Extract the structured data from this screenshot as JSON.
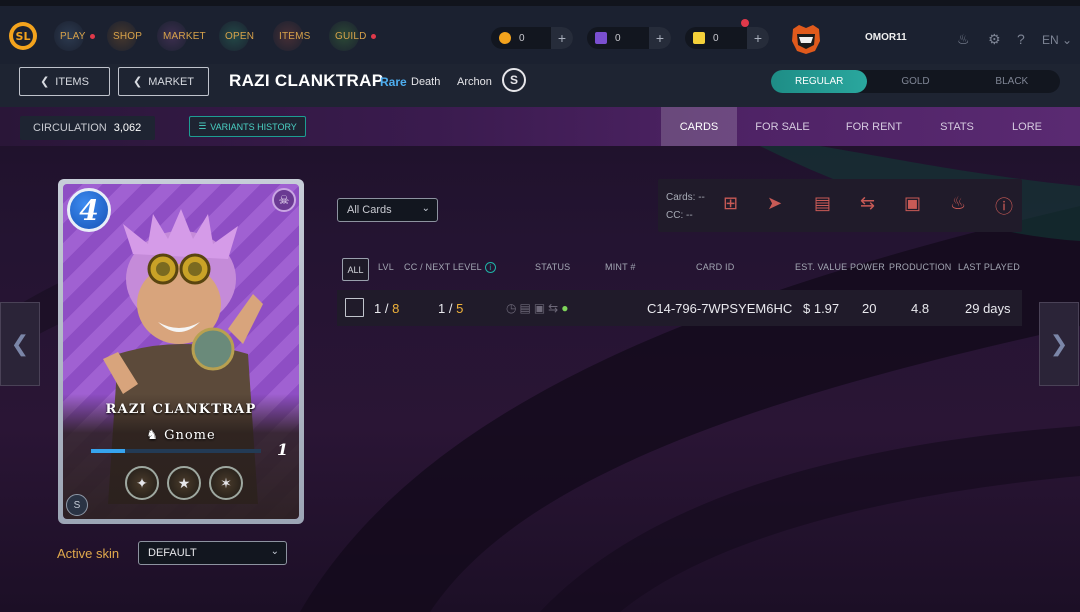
{
  "topbar": {
    "logo_text": "SL",
    "nav": [
      {
        "label": "PLAY",
        "dot": true
      },
      {
        "label": "SHOP",
        "dot": false
      },
      {
        "label": "MARKET",
        "dot": false
      },
      {
        "label": "OPEN",
        "dot": false
      },
      {
        "label": "ITEMS",
        "dot": false
      },
      {
        "label": "GUILD",
        "dot": true
      }
    ],
    "currencies": [
      {
        "icon": "credits-coin-icon",
        "value": "0",
        "color": "#f3a31d"
      },
      {
        "icon": "voucher-icon",
        "value": "0",
        "color": "#7a4fd0"
      },
      {
        "icon": "energy-icon",
        "value": "0",
        "color": "#f5d13a"
      }
    ],
    "username": "OMOR11",
    "language": "EN",
    "plus_symbol": "+"
  },
  "header": {
    "items_button": "ITEMS",
    "market_button": "MARKET",
    "card_name": "RAZI CLANKTRAP",
    "rarity": "Rare",
    "element": "Death",
    "edition": "Archon",
    "foil_options": [
      "REGULAR",
      "GOLD",
      "BLACK"
    ],
    "foil_selected": "REGULAR"
  },
  "strip": {
    "circulation_label": "CIRCULATION",
    "circulation_value": "3,062",
    "variants_history": "VARIANTS HISTORY",
    "tabs": [
      "CARDS",
      "FOR SALE",
      "FOR RENT",
      "STATS",
      "LORE"
    ],
    "active_tab": "CARDS"
  },
  "card": {
    "mana": "4",
    "name": "RAZI CLANKTRAP",
    "type": "Gnome",
    "level": "1",
    "level_progress": 0.2,
    "abilities": [
      "ability-icon-1",
      "ability-icon-2",
      "ability-icon-3"
    ]
  },
  "skin": {
    "label": "Active skin",
    "value": "DEFAULT"
  },
  "filter": {
    "value": "All Cards"
  },
  "actions": {
    "cards_line": "Cards: --",
    "cc_line": "CC: --",
    "icons": [
      "combine-icon",
      "transfer-icon",
      "market-icon",
      "delegate-icon",
      "lock-icon",
      "burn-icon",
      "info-icon"
    ]
  },
  "table": {
    "all_label": "ALL",
    "headers": {
      "lvl": "LVL",
      "cc_next": "CC / NEXT LEVEL",
      "status": "STATUS",
      "mint": "MINT #",
      "card_id": "CARD ID",
      "est_value": "EST. VALUE",
      "power": "POWER",
      "production": "PRODUCTION",
      "last_played": "LAST PLAYED"
    },
    "rows": [
      {
        "lvl_cur": "1",
        "lvl_max": "8",
        "cc_cur": "1",
        "cc_next": "5",
        "mint": "",
        "card_id": "C14-796-7WPSYEM6HC",
        "est_value": "$ 1.97",
        "power": "20",
        "production": "4.8",
        "last_played": "29 days"
      }
    ]
  }
}
